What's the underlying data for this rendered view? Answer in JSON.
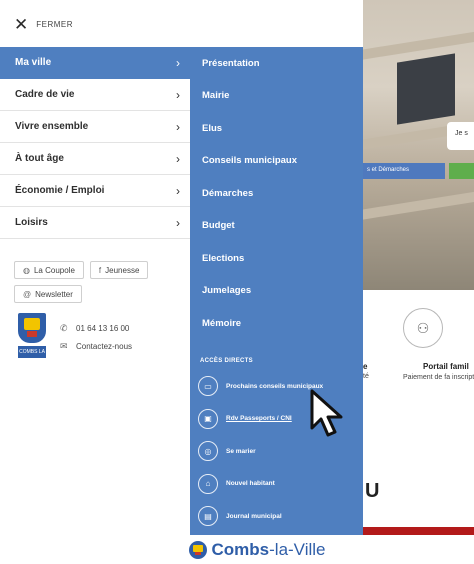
{
  "close": {
    "label": "FERMER"
  },
  "left_nav": {
    "items": [
      {
        "label": "Ma ville",
        "active": true
      },
      {
        "label": "Cadre de vie",
        "active": false
      },
      {
        "label": "Vivre ensemble",
        "active": false
      },
      {
        "label": "À tout âge",
        "active": false
      },
      {
        "label": "Économie / Emploi",
        "active": false
      },
      {
        "label": "Loisirs",
        "active": false
      }
    ],
    "chevron": "›"
  },
  "quick_links": [
    {
      "label": "La Coupole",
      "icon": "globe-icon",
      "glyph": "◍"
    },
    {
      "label": "Jeunesse",
      "icon": "facebook-icon",
      "glyph": "f"
    },
    {
      "label": "Newsletter",
      "icon": "at-icon",
      "glyph": "@"
    }
  ],
  "contact": {
    "logo_word": "COMBS LA VILLE",
    "phone": "01 64 13 16 00",
    "contact_label": "Contactez-nous"
  },
  "submenu": {
    "items": [
      {
        "label": "Présentation"
      },
      {
        "label": "Mairie"
      },
      {
        "label": "Elus"
      },
      {
        "label": "Conseils municipaux"
      },
      {
        "label": "Démarches"
      },
      {
        "label": "Budget"
      },
      {
        "label": "Elections"
      },
      {
        "label": "Jumelages"
      },
      {
        "label": "Mémoire"
      }
    ],
    "acces_directs_title": "ACCÈS DIRECTS",
    "direct_links": [
      {
        "label": "Prochains conseils municipaux",
        "icon": "calendar-icon",
        "glyph": "▭"
      },
      {
        "label": "Rdv Passeports / CNI",
        "icon": "id-card-icon",
        "glyph": "▣"
      },
      {
        "label": "Se marier",
        "icon": "rings-icon",
        "glyph": "◎"
      },
      {
        "label": "Nouvel habitant",
        "icon": "welcome-icon",
        "glyph": "⌂"
      },
      {
        "label": "Journal municipal",
        "icon": "newspaper-icon",
        "glyph": "▤"
      }
    ]
  },
  "background": {
    "speech_text": "Je s",
    "demarches_button": "s et Démarches",
    "tile_title": "Portail famil",
    "tile_desc": "Paiement de fa inscription",
    "fragment_title": "e",
    "fragment_desc": "té",
    "big_letter": "U"
  },
  "footer": {
    "brand_bold": "Combs",
    "brand_rest": "-la-Ville"
  },
  "colors": {
    "menu_blue": "#4f7fc0",
    "brand_blue": "#2f5ea8",
    "accent_red": "#b31a1a",
    "accent_green": "#5fae4c"
  }
}
